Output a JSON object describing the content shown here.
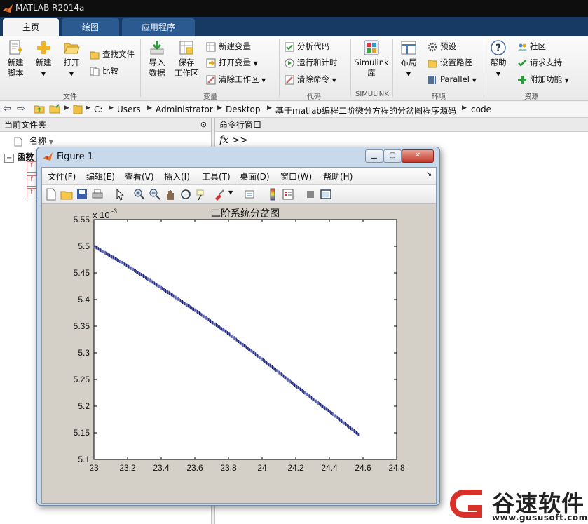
{
  "window": {
    "title": "MATLAB R2014a"
  },
  "tabs": [
    {
      "label": "主页"
    },
    {
      "label": "绘图"
    },
    {
      "label": "应用程序"
    }
  ],
  "ribbon": {
    "new_script": "新建\n脚本",
    "new": "新建",
    "open": "打开",
    "find_files": "查找文件",
    "compare": "比较",
    "import": "导入\n数据",
    "save_ws": "保存\n工作区",
    "new_var": "新建变量",
    "open_var": "打开变量",
    "clear_ws": "清除工作区",
    "analyze": "分析代码",
    "run_time": "运行和计时",
    "clear_cmd": "清除命令",
    "simulink": "Simulink\n库",
    "layout": "布局",
    "prefs": "预设",
    "set_path": "设置路径",
    "parallel": "Parallel",
    "help": "帮助",
    "community": "社区",
    "request_support": "请求支持",
    "addons": "附加功能",
    "groups": {
      "file": "文件",
      "variable": "变量",
      "code": "代码",
      "simulink": "SIMULINK",
      "environment": "环境",
      "resources": "资源"
    }
  },
  "address": {
    "crumbs": [
      "C:",
      "Users",
      "Administrator",
      "Desktop",
      "基于matlab编程二阶微分方程的分岔图程序源码",
      "code"
    ]
  },
  "current_folder": {
    "title": "当前文件夹",
    "column_name": "名称",
    "group": "函数"
  },
  "command_window": {
    "title": "命令行窗口",
    "prompt": "fx >>"
  },
  "figure": {
    "title": "Figure 1",
    "menu": [
      "文件(F)",
      "编辑(E)",
      "查看(V)",
      "插入(I)",
      "工具(T)",
      "桌面(D)",
      "窗口(W)",
      "帮助(H)"
    ]
  },
  "chart_data": {
    "type": "scatter",
    "title": "二阶系统分岔图",
    "xlabel": "",
    "ylabel": "",
    "y_exponent_label": "x 10",
    "y_exponent": "-3",
    "xlim": [
      23,
      24.8
    ],
    "ylim": [
      5.1,
      5.55
    ],
    "xticks": [
      "23",
      "23.2",
      "23.4",
      "23.6",
      "23.8",
      "24",
      "24.2",
      "24.4",
      "24.6",
      "24.8"
    ],
    "yticks": [
      "5.1",
      "5.15",
      "5.2",
      "5.25",
      "5.3",
      "5.35",
      "5.4",
      "5.45",
      "5.5",
      "5.55"
    ],
    "series": [
      {
        "color": "#1a237e",
        "points": [
          [
            23.0,
            5.5
          ],
          [
            23.2,
            5.463
          ],
          [
            23.4,
            5.422
          ],
          [
            23.6,
            5.38
          ],
          [
            23.8,
            5.336
          ],
          [
            24.0,
            5.288
          ],
          [
            24.2,
            5.238
          ],
          [
            24.4,
            5.19
          ],
          [
            24.58,
            5.145
          ]
        ]
      }
    ]
  },
  "watermark": {
    "text": "谷速软件",
    "url": "www.gususoft.com",
    "color": "#d9302a"
  }
}
